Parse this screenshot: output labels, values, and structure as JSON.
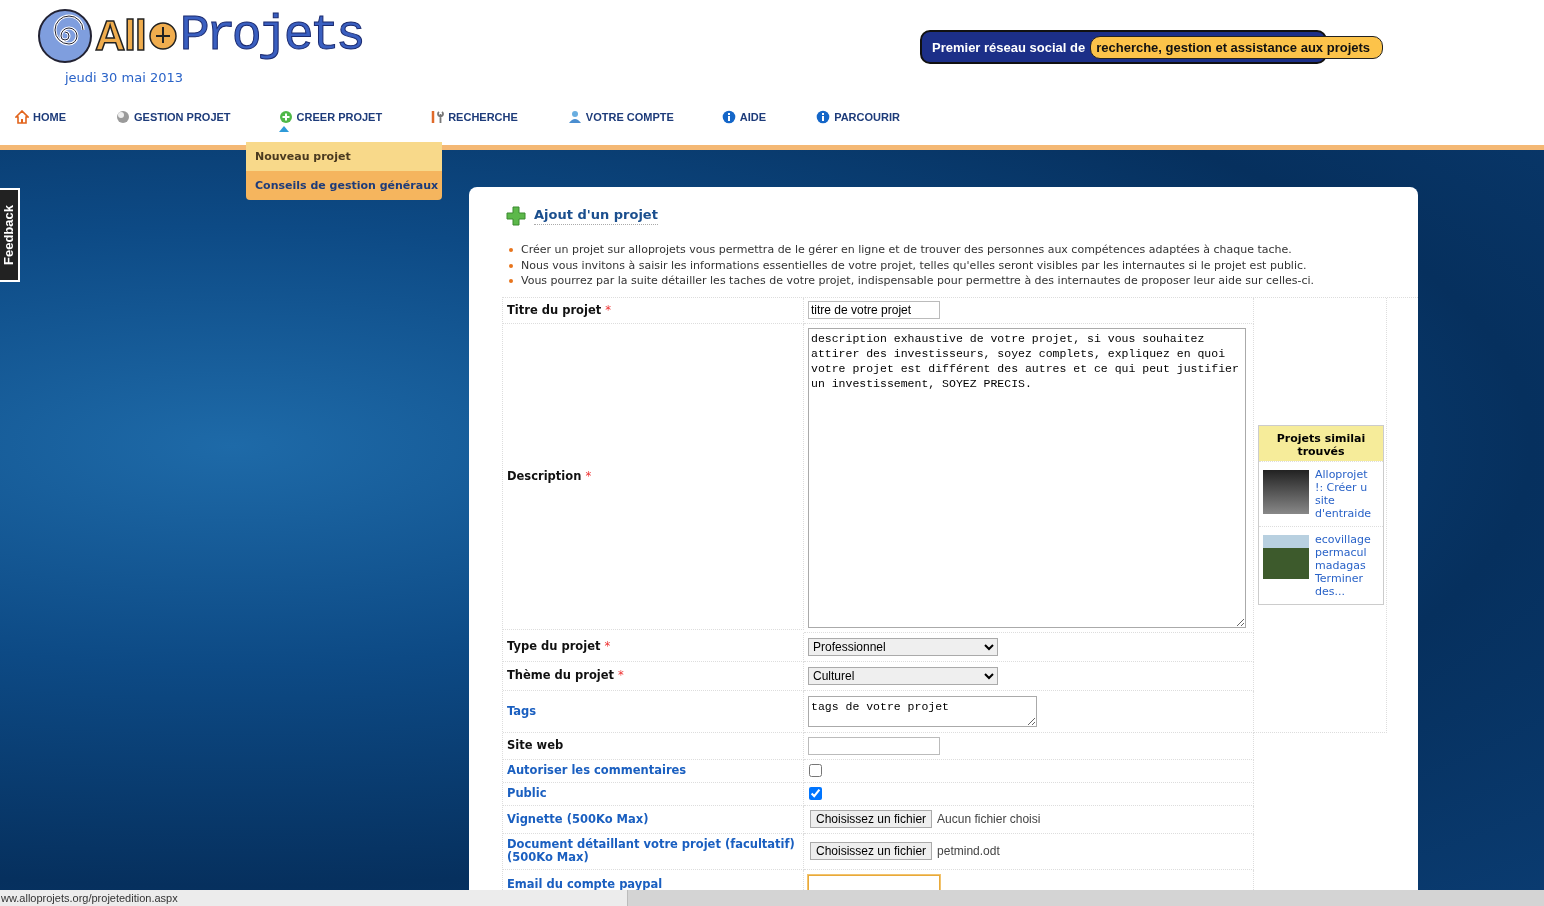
{
  "header": {
    "logo": {
      "left": "All",
      "right": "Projets"
    },
    "date": "jeudi 30 mai 2013",
    "banner": {
      "lead": "Premier réseau social de",
      "highlight": "recherche, gestion et assistance aux projets"
    }
  },
  "nav": {
    "items": [
      {
        "label": "HOME",
        "selected": false
      },
      {
        "label": "GESTION PROJET",
        "selected": false
      },
      {
        "label": "CREER PROJET",
        "selected": true
      },
      {
        "label": "RECHERCHE",
        "selected": false
      },
      {
        "label": "VOTRE COMPTE",
        "selected": false
      },
      {
        "label": "AIDE",
        "selected": false
      },
      {
        "label": "PARCOURIR",
        "selected": false
      }
    ],
    "submenu": [
      {
        "label": "Nouveau projet",
        "selected": false
      },
      {
        "label": "Conseils de gestion généraux",
        "selected": true
      }
    ]
  },
  "feedback_tab": "Feedback",
  "form": {
    "title": "Ajout d'un projet",
    "intro": [
      "Créer un projet sur alloprojets vous permettra de le gérer en ligne et de trouver des personnes aux compétences adaptées à chaque tache.",
      "Nous vous invitons à saisir les informations essentielles de votre projet, telles qu'elles seront visibles par les internautes si le projet est public.",
      "Vous pourrez par la suite détailler les taches de votre projet, indispensable pour permettre à des internautes de proposer leur aide sur celles-ci."
    ],
    "fields": [
      {
        "kind": "text",
        "label": "Titre du projet",
        "mark": "*",
        "link": false,
        "value": "titre de votre projet"
      },
      {
        "kind": "textarea",
        "label": "Description",
        "mark": "*",
        "link": false,
        "value": "description exhaustive de votre projet, si vous souhaitez attirer des investisseurs, soyez complets, expliquez en quoi votre projet est différent des autres et ce qui peut justifier un investissement, SOYEZ PRECIS."
      },
      {
        "kind": "select",
        "label": "Type du projet",
        "mark": "*",
        "link": false,
        "value": "Professionnel"
      },
      {
        "kind": "select",
        "label": "Thème du projet",
        "mark": "*",
        "link": false,
        "value": "Culturel"
      },
      {
        "kind": "tags",
        "label": "Tags",
        "link": true,
        "value": "tags de votre projet"
      },
      {
        "kind": "text",
        "label": "Site web",
        "link": false
      },
      {
        "kind": "checkbox",
        "label": "Autoriser les commentaires",
        "link": true,
        "checked": false
      },
      {
        "kind": "checkbox",
        "label": "Public",
        "link": true,
        "checked": true
      },
      {
        "kind": "file",
        "label": "Vignette (500Ko Max)",
        "link": true,
        "button": "Choisissez un fichier",
        "file": "Aucun fichier choisi"
      },
      {
        "kind": "file",
        "label": "Document détaillant votre projet (facultatif) (500Ko Max)",
        "link": true,
        "button": "Choisissez un fichier",
        "file": "petmind.odt"
      },
      {
        "kind": "text",
        "label": "Email du compte paypal",
        "link": true,
        "focused": true
      }
    ],
    "similar": {
      "title": "Projets similai trouvés",
      "items": [
        {
          "text": "Alloprojet !: Créer u site d'entraide"
        },
        {
          "text": "ecovillage permacul madagas Terminer des..."
        }
      ]
    }
  },
  "status_bar": "ww.alloprojets.org/projetedition.aspx"
}
